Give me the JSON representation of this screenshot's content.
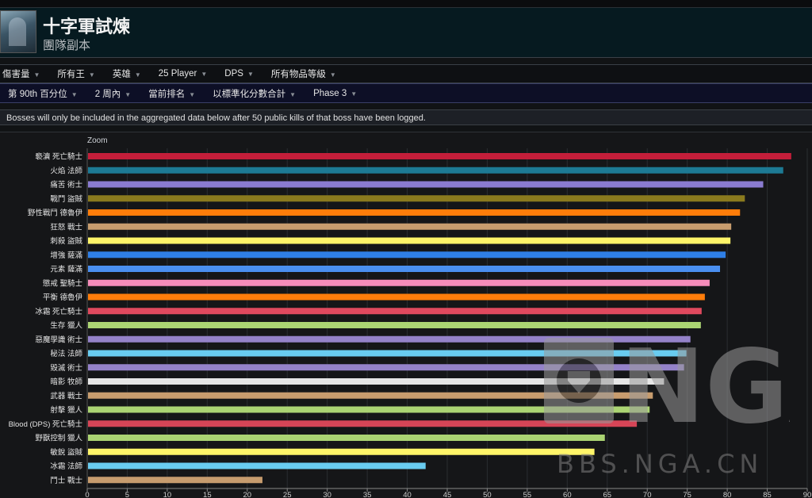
{
  "header": {
    "title": "十字軍試煉",
    "subtitle": "團隊副本"
  },
  "filters_row1": [
    "傷害量",
    "所有王",
    "英雄",
    "25 Player",
    "DPS",
    "所有物品等級"
  ],
  "filters_row2": [
    "第 90th 百分位",
    "2 周內",
    "當前排名",
    "以標準化分數合計",
    "Phase 3"
  ],
  "notice": "Bosses will only be included in the aggregated data below after 50 public kills of that boss have been logged.",
  "zoom_label": "Zoom",
  "watermark": {
    "logo": "NGA",
    "site": "BBS.NGA.CN"
  },
  "chart_data": {
    "type": "bar",
    "orientation": "horizontal",
    "categories": [
      "褻瀆 死亡騎士",
      "火焰 法師",
      "痛苦 術士",
      "戰鬥 盜賊",
      "野性戰鬥 德魯伊",
      "狂怒 戰士",
      "刺殺 盜賊",
      "增強 薩滿",
      "元素 薩滿",
      "懲戒 聖騎士",
      "平衡 德魯伊",
      "冰霜 死亡騎士",
      "生存 獵人",
      "惡魔學識 術士",
      "秘法 法師",
      "毀滅 術士",
      "暗影 牧師",
      "武器 戰士",
      "射擊 獵人",
      "Blood (DPS) 死亡騎士",
      "野獸控制 獵人",
      "敏銳 盜賊",
      "冰霜 法師",
      "鬥士 戰士"
    ],
    "values": [
      88.0,
      87.0,
      84.5,
      82.2,
      81.6,
      80.5,
      80.4,
      79.8,
      79.1,
      77.8,
      77.2,
      76.8,
      76.7,
      75.4,
      74.9,
      74.6,
      72.1,
      70.7,
      70.3,
      68.7,
      64.7,
      63.4,
      42.3,
      21.9
    ],
    "colors": [
      "#c41e3a",
      "#1d7a94",
      "#8a7bd0",
      "#8a7a1e",
      "#ff7d0a",
      "#c79c6e",
      "#fff569",
      "#2f7fe6",
      "#4a8ff0",
      "#f58cba",
      "#ff7d0a",
      "#e0495e",
      "#abd473",
      "#9482c9",
      "#69ccf0",
      "#9482c9",
      "#e6e6e6",
      "#c79c6e",
      "#abd473",
      "#d64557",
      "#abd473",
      "#fff569",
      "#69ccf0",
      "#c79c6e"
    ],
    "xlim": [
      0,
      90
    ],
    "xticks": [
      0,
      5,
      10,
      15,
      20,
      25,
      30,
      35,
      40,
      45,
      50,
      55,
      60,
      65,
      70,
      75,
      80,
      85,
      90
    ],
    "grid": true
  }
}
